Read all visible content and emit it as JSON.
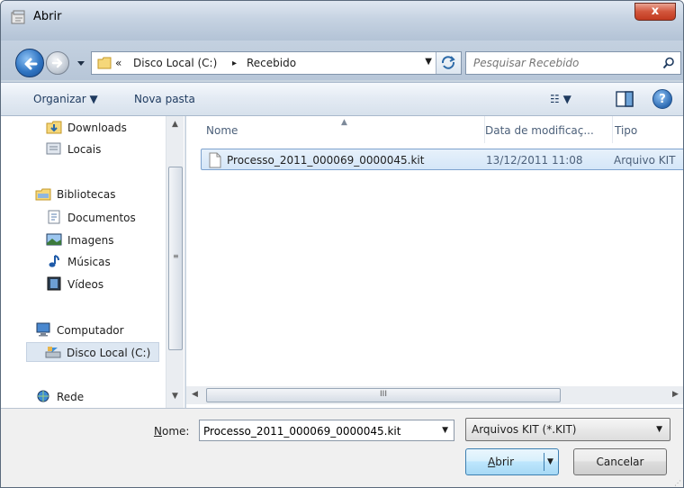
{
  "window": {
    "title": "Abrir",
    "close_label": "x"
  },
  "nav": {
    "address": {
      "prefix": "«",
      "crumbs": [
        "Disco Local (C:)",
        "Recebido"
      ],
      "separator": "▸"
    },
    "search_placeholder": "Pesquisar Recebido"
  },
  "toolbar": {
    "organize_label": "Organizar ▼",
    "new_folder_label": "Nova pasta",
    "views_label": "☷ ▼",
    "help_label": "?"
  },
  "sidebar": {
    "items": [
      {
        "label": "Downloads",
        "icon": "downloads-icon"
      },
      {
        "label": "Locais",
        "icon": "places-icon"
      },
      {
        "label": "Bibliotecas",
        "icon": "library-icon"
      },
      {
        "label": "Documentos",
        "icon": "documents-icon"
      },
      {
        "label": "Imagens",
        "icon": "pictures-icon"
      },
      {
        "label": "Músicas",
        "icon": "music-icon"
      },
      {
        "label": "Vídeos",
        "icon": "videos-icon"
      },
      {
        "label": "Computador",
        "icon": "computer-icon"
      },
      {
        "label": "Disco Local (C:)",
        "icon": "drive-icon",
        "selected": true
      },
      {
        "label": "Rede",
        "icon": "network-icon"
      }
    ]
  },
  "filelist": {
    "columns": [
      "Nome",
      "Data de modificaç...",
      "Tipo"
    ],
    "rows": [
      {
        "name": "Processo_2011_000069_0000045.kit",
        "date": "13/12/2011 11:08",
        "type": "Arquivo KIT"
      }
    ],
    "hscroll_grip": "III"
  },
  "bottom": {
    "name_label": "Nome:",
    "name_label_accel": "N",
    "name_label_rest": "ome:",
    "name_value": "Processo_2011_000069_0000045.kit",
    "type_value": "Arquivos KIT (*.KIT)",
    "open_label": "Abrir",
    "open_accel": "A",
    "open_rest": "brir",
    "cancel_label": "Cancelar"
  },
  "colors": {
    "accent": "#3c7fb1",
    "selection": "#d4e6f8",
    "window_chrome": "#c6d3e2"
  }
}
